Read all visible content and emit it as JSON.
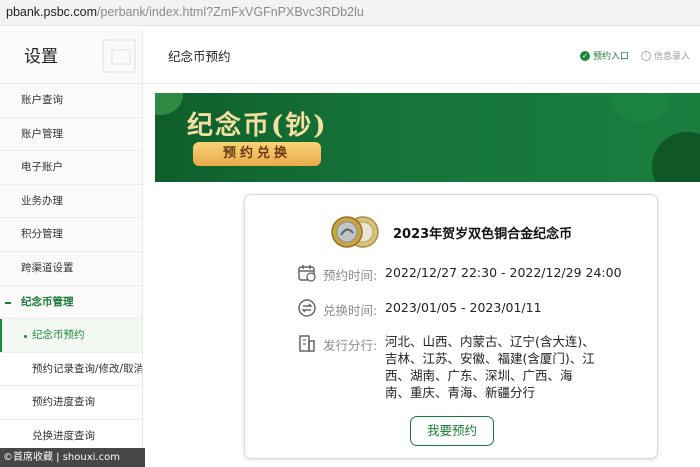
{
  "browser": {
    "url_host": "pbank.psbc.com",
    "url_path": "/perbank/index.html?ZmFxVGFnPXBvc3RDb2lu"
  },
  "sidebar": {
    "title": "设置",
    "items": [
      {
        "label": "账户查询"
      },
      {
        "label": "账户管理"
      },
      {
        "label": "电子账户"
      },
      {
        "label": "业务办理"
      },
      {
        "label": "积分管理"
      },
      {
        "label": "跨渠道设置"
      }
    ],
    "group": {
      "label": "纪念币管理"
    },
    "sub_items": [
      {
        "label": "纪念币预约"
      },
      {
        "label": "预约记录查询/修改/取消"
      },
      {
        "label": "预约进度查询"
      },
      {
        "label": "兑换进度查询"
      }
    ]
  },
  "header": {
    "title": "纪念币预约",
    "link_reserve": "预约入口",
    "link_info": "信息录入"
  },
  "banner": {
    "title": "纪念币(钞)",
    "button": "预约兑换"
  },
  "card": {
    "title": "2023年贺岁双色铜合金纪念币",
    "reserve_label": "预约时间:",
    "reserve_value": "2022/12/27 22:30 - 2022/12/29 24:00",
    "exchange_label": "兑换时间:",
    "exchange_value": "2023/01/05 - 2023/01/11",
    "branch_label": "发行分行:",
    "branch_value": "河北、山西、内蒙古、辽宁(含大连)、吉林、江苏、安徽、福建(含厦门)、江西、湖南、广东、深圳、广西、海南、重庆、青海、新疆分行",
    "button": "我要预约"
  },
  "watermark": {
    "text": "©首席收藏 | shouxi.com"
  },
  "colors": {
    "accent": "#1c7a37",
    "banner": "#16753a",
    "gold": "#f3dfa1"
  },
  "icons": [
    "calendar-icon",
    "exchange-icon",
    "building-icon",
    "coin-icon",
    "check-circle-icon",
    "info-circle-icon"
  ]
}
